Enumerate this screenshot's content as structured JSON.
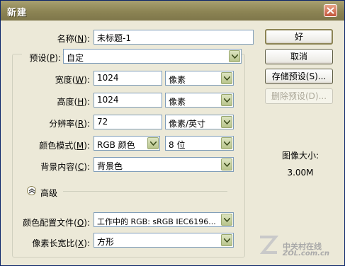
{
  "window": {
    "title": "新建"
  },
  "name": {
    "label": "名称(",
    "key": "N",
    "suffix": "):",
    "value": "未标题-1"
  },
  "preset": {
    "label": "预设(",
    "key": "P",
    "suffix": "):",
    "value": "自定"
  },
  "width": {
    "label": "宽度(",
    "key": "W",
    "suffix": "):",
    "value": "1024",
    "unit": "像素"
  },
  "height": {
    "label": "高度(",
    "key": "H",
    "suffix": "):",
    "value": "1024",
    "unit": "像素"
  },
  "resolution": {
    "label": "分辨率(",
    "key": "R",
    "suffix": "):",
    "value": "72",
    "unit": "像素/英寸"
  },
  "color_mode": {
    "label": "颜色模式(",
    "key": "M",
    "suffix": "):",
    "value": "RGB 颜色",
    "depth": "8 位"
  },
  "background": {
    "label": "背景内容(",
    "key": "C",
    "suffix": "):",
    "value": "背景色"
  },
  "advanced": {
    "label": "高级"
  },
  "color_profile": {
    "label": "颜色配置文件(",
    "key": "O",
    "suffix": "):",
    "value": "工作中的 RGB: sRGB IEC6196..."
  },
  "pixel_aspect": {
    "label": "像素长宽比(",
    "key": "X",
    "suffix": "):",
    "value": "方形"
  },
  "buttons": {
    "ok": "好",
    "cancel": "取消",
    "save_preset": "存储预设(S)...",
    "delete_preset": "删除预设(D)..."
  },
  "image_size": {
    "label": "图像大小:",
    "value": "3.00M"
  },
  "watermark": {
    "text": "中关村在线",
    "sub": "ZOL.com.cn"
  }
}
